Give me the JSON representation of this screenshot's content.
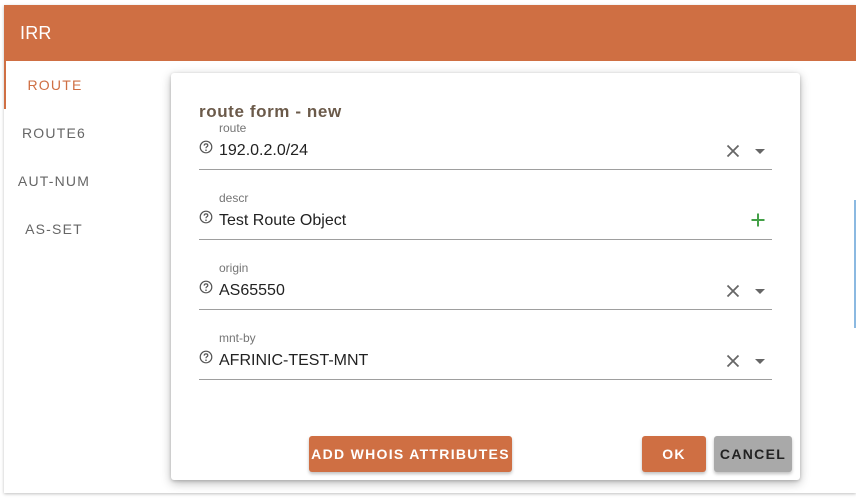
{
  "app": {
    "title": "IRR"
  },
  "sidebar": {
    "items": [
      {
        "label": "ROUTE",
        "active": true
      },
      {
        "label": "ROUTE6",
        "active": false
      },
      {
        "label": "AUT-NUM",
        "active": false
      },
      {
        "label": "AS-SET",
        "active": false
      }
    ]
  },
  "dialog": {
    "title": "route form - new",
    "fields": [
      {
        "label": "route",
        "value": "192.0.2.0/24",
        "control": "select"
      },
      {
        "label": "descr",
        "value": "Test Route Object",
        "control": "add"
      },
      {
        "label": "origin",
        "value": "AS65550",
        "control": "select"
      },
      {
        "label": "mnt-by",
        "value": "AFRINIC-TEST-MNT",
        "control": "select"
      }
    ],
    "buttons": {
      "add_whois": "ADD WHOIS ATTRIBUTES",
      "ok": "OK",
      "cancel": "CANCEL"
    }
  },
  "colors": {
    "accent": "#cf6f43",
    "add_icon": "#43a047",
    "title_text": "#6b5a4a",
    "cancel_bg": "#a9a9a9"
  },
  "icons": [
    "help-circle-icon",
    "clear-x-icon",
    "dropdown-arrow-icon",
    "plus-icon"
  ]
}
